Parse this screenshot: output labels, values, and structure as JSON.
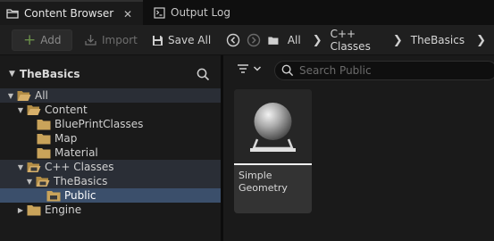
{
  "tabs": [
    {
      "label": "Content Browser",
      "icon": "folder-icon",
      "active": true
    },
    {
      "label": "Output Log",
      "icon": "terminal-icon",
      "active": false
    }
  ],
  "tab_close_icon": "✕",
  "toolbar": {
    "add_label": "Add",
    "import_label": "Import",
    "save_all_label": "Save All"
  },
  "breadcrumb": {
    "items": [
      "All",
      "C++ Classes",
      "TheBasics"
    ]
  },
  "sources_panel": {
    "title": "TheBasics",
    "tree": [
      {
        "label": "All",
        "depth": 0,
        "expanded": true,
        "icon": "folder-open-icon"
      },
      {
        "label": "Content",
        "depth": 1,
        "expanded": true,
        "icon": "folder-open-icon"
      },
      {
        "label": "BluePrintClasses",
        "depth": 2,
        "icon": "folder-icon"
      },
      {
        "label": "Map",
        "depth": 2,
        "icon": "folder-icon"
      },
      {
        "label": "Material",
        "depth": 2,
        "icon": "folder-icon"
      },
      {
        "label": "C++ Classes",
        "depth": 1,
        "expanded": true,
        "icon": "cpp-folder-icon"
      },
      {
        "label": "TheBasics",
        "depth": 2,
        "expanded": true,
        "icon": "cpp-folder-icon"
      },
      {
        "label": "Public",
        "depth": 3,
        "icon": "cpp-folder-icon",
        "selected": true
      },
      {
        "label": "Engine",
        "depth": 1,
        "expanded": false,
        "icon": "folder-icon"
      }
    ]
  },
  "search": {
    "placeholder": "Search Public"
  },
  "assets": [
    {
      "name": "Simple Geometry",
      "type": "cpp-class"
    }
  ],
  "colors": {
    "folder": "#c9a35a",
    "selection": "#3b4f6b",
    "highlight": "#2a2e36",
    "add_plus": "#6a8f4a"
  }
}
